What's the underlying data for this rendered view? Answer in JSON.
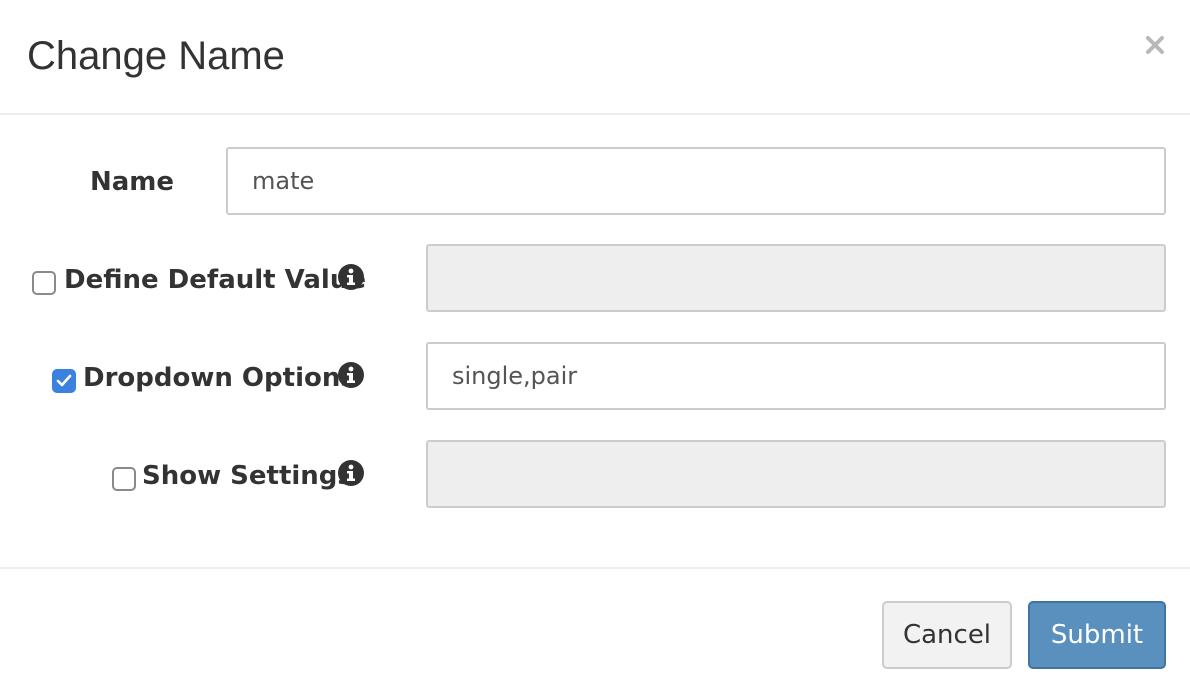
{
  "dialog": {
    "title": "Change Name",
    "close_label": "×"
  },
  "form": {
    "name": {
      "label": "Name",
      "value": "mate"
    },
    "default_value": {
      "label": "Define Default Value",
      "checked": false,
      "value": "",
      "disabled": true,
      "info_icon": "info-circle-icon"
    },
    "dropdown_options": {
      "label": "Dropdown Options",
      "checked": true,
      "value": "single,pair",
      "disabled": false,
      "info_icon": "info-circle-icon"
    },
    "show_settings": {
      "label": "Show Settings",
      "checked": false,
      "value": "",
      "disabled": true,
      "info_icon": "info-circle-icon"
    }
  },
  "footer": {
    "cancel_label": "Cancel",
    "submit_label": "Submit"
  },
  "colors": {
    "primary_button": "#5a90bd",
    "checkbox_checked": "#3b82e0",
    "disabled_field": "#eeeeee",
    "border": "#cccccc"
  }
}
